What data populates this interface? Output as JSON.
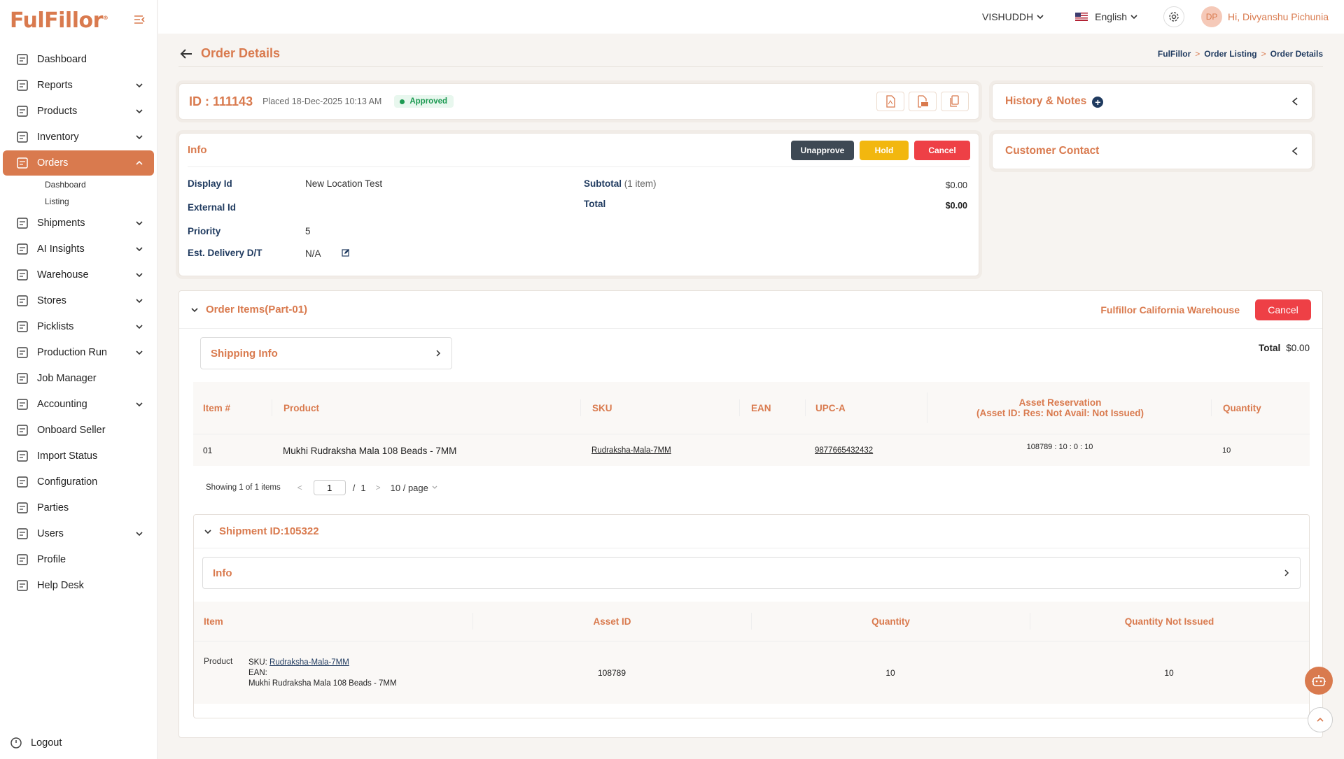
{
  "brand": {
    "name": "FulFillor",
    "mark": "®"
  },
  "sidebar": {
    "items": [
      {
        "key": "dashboard",
        "label": "Dashboard",
        "chev": false
      },
      {
        "key": "reports",
        "label": "Reports",
        "chev": true
      },
      {
        "key": "products",
        "label": "Products",
        "chev": true
      },
      {
        "key": "inventory",
        "label": "Inventory",
        "chev": true
      },
      {
        "key": "orders",
        "label": "Orders",
        "chev": true,
        "active": true
      },
      {
        "key": "shipments",
        "label": "Shipments",
        "chev": true
      },
      {
        "key": "ai-insights",
        "label": "AI Insights",
        "chev": true
      },
      {
        "key": "warehouse",
        "label": "Warehouse",
        "chev": true
      },
      {
        "key": "stores",
        "label": "Stores",
        "chev": true
      },
      {
        "key": "picklists",
        "label": "Picklists",
        "chev": true
      },
      {
        "key": "production-run",
        "label": "Production Run",
        "chev": true
      },
      {
        "key": "job-manager",
        "label": "Job Manager",
        "chev": false
      },
      {
        "key": "accounting",
        "label": "Accounting",
        "chev": true
      },
      {
        "key": "onboard-seller",
        "label": "Onboard Seller",
        "chev": false
      },
      {
        "key": "import-status",
        "label": "Import Status",
        "chev": false
      },
      {
        "key": "configuration",
        "label": "Configuration",
        "chev": false
      },
      {
        "key": "parties",
        "label": "Parties",
        "chev": false
      },
      {
        "key": "users",
        "label": "Users",
        "chev": true
      },
      {
        "key": "profile",
        "label": "Profile",
        "chev": false
      },
      {
        "key": "help-desk",
        "label": "Help Desk",
        "chev": false
      }
    ],
    "orders_sub": [
      "Dashboard",
      "Listing"
    ],
    "logout": "Logout"
  },
  "header": {
    "company": "VISHUDDH",
    "language": "English",
    "avatar_initials": "DP",
    "greeting": "Hi, Divyanshu Pichunia"
  },
  "page": {
    "title": "Order Details",
    "breadcrumb": [
      "FulFillor",
      "Order Listing",
      "Order Details"
    ]
  },
  "order": {
    "id_label": "ID : 111143",
    "placed": "Placed 18-Dec-2025 10:13 AM",
    "status": "Approved"
  },
  "info": {
    "title": "Info",
    "unapprove": "Unapprove",
    "hold": "Hold",
    "cancel": "Cancel",
    "display_id_k": "Display Id",
    "display_id_v": "New Location Test",
    "external_id_k": "External Id",
    "priority_k": "Priority",
    "priority_v": "5",
    "est_k": "Est. Delivery D/T",
    "est_v": "N/A",
    "subtotal_k": "Subtotal",
    "subtotal_note": "(1 item)",
    "subtotal_v": "$0.00",
    "total_k": "Total",
    "total_v": "$0.00"
  },
  "side": {
    "history": "History & Notes",
    "contact": "Customer Contact"
  },
  "items": {
    "title": "Order Items(Part-01)",
    "warehouse": "Fulfillor California Warehouse",
    "cancel": "Cancel",
    "shipping_info": "Shipping Info",
    "total_k": "Total",
    "total_v": "$0.00",
    "headers": {
      "item": "Item #",
      "product": "Product",
      "sku": "SKU",
      "ean": "EAN",
      "upc": "UPC-A",
      "asset1": "Asset Reservation",
      "asset2": "(Asset ID: Res: Not Avail: Not Issued)",
      "qty": "Quantity"
    },
    "rows": [
      {
        "item": "01",
        "product": "Mukhi Rudraksha Mala 108 Beads - 7MM",
        "sku": "Rudraksha-Mala-7MM",
        "ean": "",
        "upc": "9877665432432",
        "asset": "108789 : 10 : 0 : 10",
        "qty": "10"
      }
    ],
    "pager": {
      "showing": "Showing 1 of 1 items",
      "page": "1",
      "of": "/",
      "total": "1",
      "per": "10 / page"
    }
  },
  "shipment": {
    "title": "Shipment ID:105322",
    "info": "Info",
    "headers": {
      "item": "Item",
      "asset": "Asset ID",
      "qty": "Quantity",
      "qni": "Quantity Not Issued"
    },
    "row": {
      "img_alt": "Product",
      "sku_k": "SKU:",
      "sku_v": "Rudraksha-Mala-7MM",
      "ean_k": "EAN:",
      "name": "Mukhi Rudraksha Mala 108 Beads - 7MM",
      "asset": "108789",
      "qty": "10",
      "qni": "10"
    }
  },
  "colors": {
    "accent": "#d97a4e",
    "navy": "#1f3a5f",
    "approved": "#1d9a52",
    "danger": "#ee4046",
    "warning": "#f2b70f"
  }
}
